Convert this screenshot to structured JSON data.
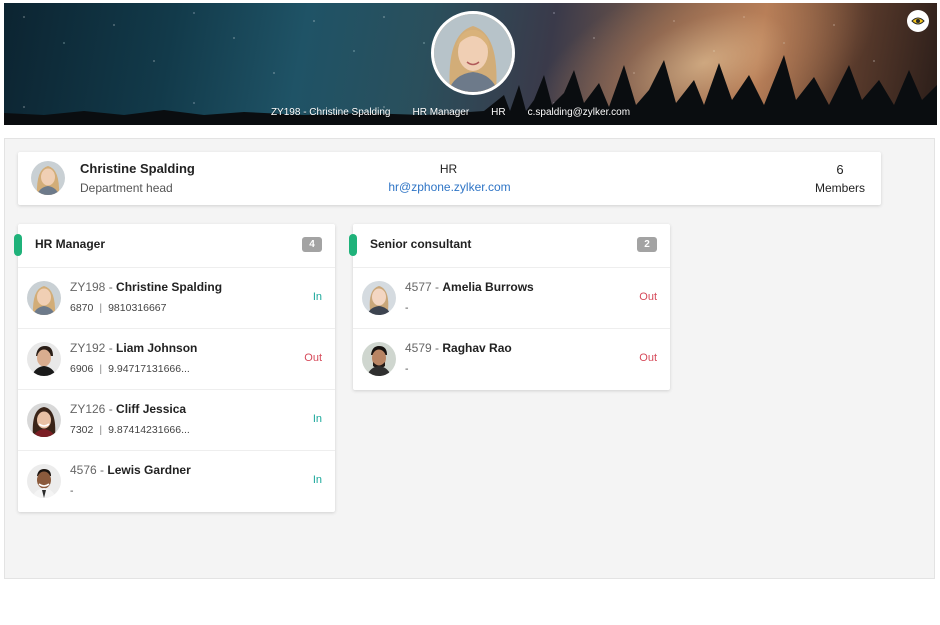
{
  "banner": {
    "employee_id_name": "ZY198 - Christine Spalding",
    "designation": "HR Manager",
    "department": "HR",
    "email": "c.spalding@zylker.com",
    "eye_icon": "eye-icon"
  },
  "department_head": {
    "name": "Christine Spalding",
    "role": "Department head",
    "department": "HR",
    "department_email": "hr@zphone.zylker.com",
    "member_count": "6",
    "member_label": "Members"
  },
  "groups": [
    {
      "title": "HR Manager",
      "count": "4",
      "members": [
        {
          "id": "ZY198",
          "sep": " - ",
          "name": "Christine Spalding",
          "ext": "6870",
          "phone": "9810316667",
          "status": "In"
        },
        {
          "id": "ZY192",
          "sep": " - ",
          "name": "Liam Johnson",
          "ext": "6906",
          "phone": "9.94717131666...",
          "status": "Out"
        },
        {
          "id": "ZY126",
          "sep": " - ",
          "name": "Cliff Jessica",
          "ext": "7302",
          "phone": "9.87414231666...",
          "status": "In"
        },
        {
          "id": "4576",
          "sep": " - ",
          "name": "Lewis Gardner",
          "ext": "-",
          "phone": "",
          "status": "In"
        }
      ]
    },
    {
      "title": "Senior consultant",
      "count": "2",
      "members": [
        {
          "id": "4577",
          "sep": " - ",
          "name": "Amelia Burrows",
          "ext": "-",
          "phone": "",
          "status": "Out"
        },
        {
          "id": "4579",
          "sep": " - ",
          "name": "Raghav Rao",
          "ext": "-",
          "phone": "",
          "status": "Out"
        }
      ]
    }
  ],
  "colors": {
    "in": "#1aa89a",
    "out": "#d64a5a",
    "accent": "#1fb27a",
    "link": "#2f75c6"
  }
}
